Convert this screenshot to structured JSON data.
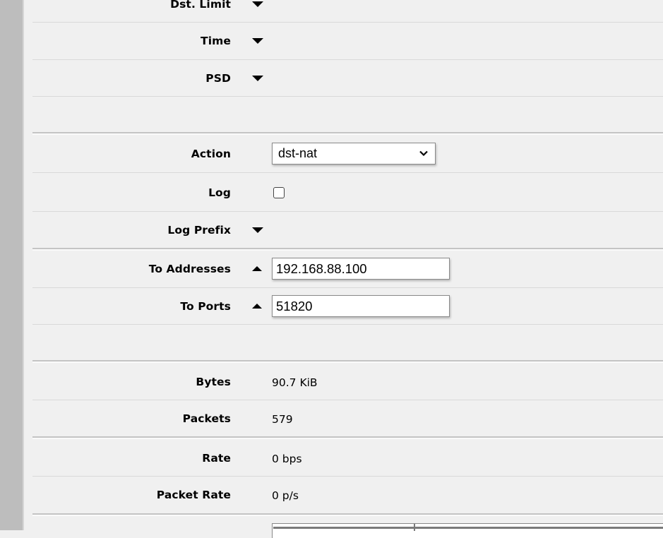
{
  "form": {
    "dst_limit": {
      "label": "Dst. Limit",
      "arrow": "down"
    },
    "time": {
      "label": "Time",
      "arrow": "down"
    },
    "psd": {
      "label": "PSD",
      "arrow": "down"
    },
    "action": {
      "label": "Action",
      "value": "dst-nat"
    },
    "log": {
      "label": "Log",
      "checked": false
    },
    "log_prefix": {
      "label": "Log Prefix",
      "arrow": "down"
    },
    "to_addresses": {
      "label": "To Addresses",
      "arrow": "up",
      "value": "192.168.88.100"
    },
    "to_ports": {
      "label": "To Ports",
      "arrow": "up",
      "value": "51820"
    }
  },
  "stats": {
    "bytes": {
      "label": "Bytes",
      "value": "90.7 KiB"
    },
    "packets": {
      "label": "Packets",
      "value": "579"
    },
    "rate": {
      "label": "Rate",
      "value": "0 bps"
    },
    "packet_rate": {
      "label": "Packet Rate",
      "value": "0 p/s"
    }
  },
  "icons": {
    "collapsed": "triangle-down",
    "expanded": "triangle-up",
    "select": "chevron-down"
  }
}
